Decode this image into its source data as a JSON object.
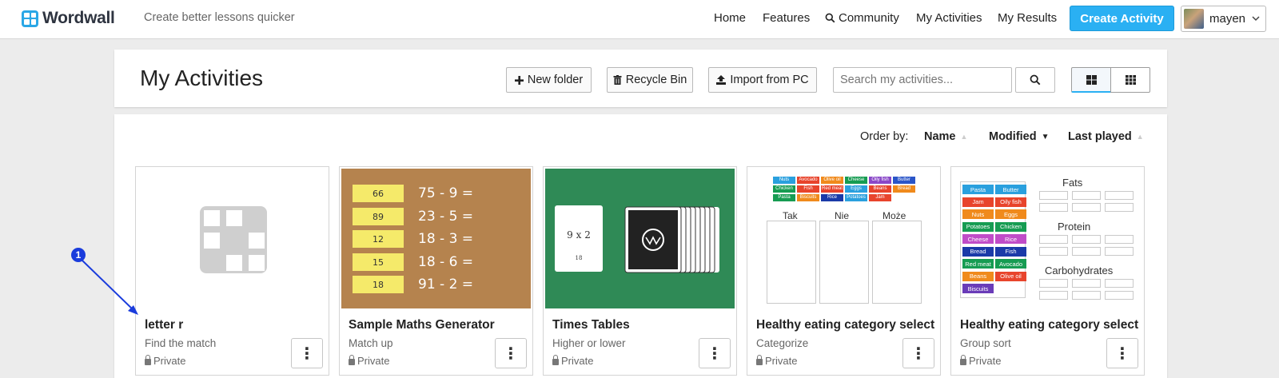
{
  "app": {
    "name": "Wordwall",
    "tagline": "Create better lessons quicker"
  },
  "nav": {
    "home": "Home",
    "features": "Features",
    "community": "Community",
    "my_activities": "My Activities",
    "my_results": "My Results",
    "create": "Create Activity",
    "user": "mayen"
  },
  "page": {
    "title": "My Activities"
  },
  "toolbar": {
    "new_folder": "New folder",
    "recycle_bin": "Recycle Bin",
    "import": "Import from PC",
    "search_placeholder": "Search my activities..."
  },
  "order": {
    "label": "Order by:",
    "name": "Name",
    "modified": "Modified",
    "last_played": "Last played"
  },
  "cards": [
    {
      "title": "letter r",
      "type": "Find the match",
      "privacy": "Private"
    },
    {
      "title": "Sample Maths Generator",
      "type": "Match up",
      "privacy": "Private"
    },
    {
      "title": "Times Tables",
      "type": "Higher or lower",
      "privacy": "Private"
    },
    {
      "title": "Healthy eating category select",
      "type": "Categorize",
      "privacy": "Private"
    },
    {
      "title": "Healthy eating category select",
      "type": "Group sort",
      "privacy": "Private"
    }
  ],
  "thumbs": {
    "maths": {
      "notes": [
        "66",
        "89",
        "12",
        "15",
        "18"
      ],
      "sums": [
        "75 - 9 =",
        "23 - 5 =",
        "18 - 3 =",
        "18 - 6 =",
        "91 - 2 ="
      ]
    },
    "times": {
      "card_text": "9 x 2",
      "card_small": "18"
    },
    "categorize": {
      "items": [
        "Nuts",
        "Avocado",
        "Olive oil",
        "Cheese",
        "Oily fish",
        "Butter",
        "Chicken",
        "Fish",
        "Red meat",
        "Eggs",
        "Beans",
        "Bread",
        "Pasta",
        "Biscuits",
        "Rice",
        "Potatoes",
        "Jam"
      ],
      "columns": [
        "Tak",
        "Nie",
        "Może"
      ]
    },
    "groupsort": {
      "items": [
        "Pasta",
        "Butter",
        "Jam",
        "Oily fish",
        "Nuts",
        "Eggs",
        "Potatoes",
        "Chicken",
        "Cheese",
        "Rice",
        "Bread",
        "Fish",
        "Red meat",
        "Avocado",
        "Beans",
        "Olive oil",
        "Biscuits"
      ],
      "groups": [
        "Fats",
        "Protein",
        "Carbohydrates"
      ]
    }
  },
  "annotation": {
    "number": "1"
  },
  "colors": {
    "accent": "#2ab0f3",
    "annotation": "#1a3cdc"
  }
}
